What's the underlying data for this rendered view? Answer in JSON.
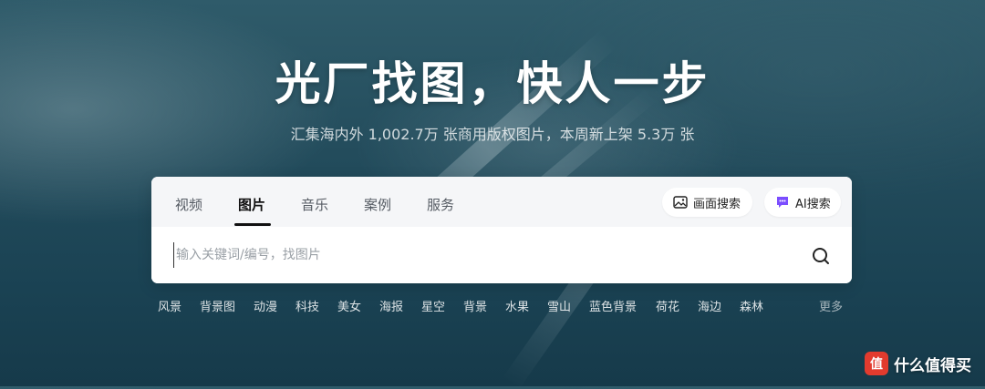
{
  "hero": {
    "title": "光厂找图，快人一步",
    "subtitle": "汇集海内外 1,002.7万 张商用版权图片，本周新上架 5.3万 张"
  },
  "tabs": [
    {
      "label": "视频"
    },
    {
      "label": "图片",
      "active": true
    },
    {
      "label": "音乐"
    },
    {
      "label": "案例"
    },
    {
      "label": "服务"
    }
  ],
  "actions": {
    "image_search": "画面搜索",
    "ai_search": "AI搜索"
  },
  "search": {
    "placeholder": "输入关键词/编号，找图片",
    "value": ""
  },
  "tags": [
    "风景",
    "背景图",
    "动漫",
    "科技",
    "美女",
    "海报",
    "星空",
    "背景",
    "水果",
    "雪山",
    "蓝色背景",
    "荷花",
    "海边",
    "森林"
  ],
  "more_label": "更多",
  "watermark": {
    "logo_char": "值",
    "text": "什么值得买"
  },
  "colors": {
    "watermark_red": "#e23b2e",
    "ai_icon_purple": "#7b4dff"
  }
}
